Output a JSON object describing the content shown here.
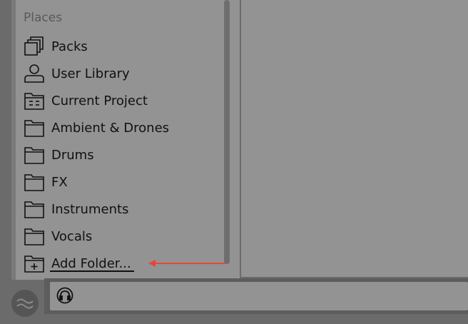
{
  "places": {
    "title": "Places",
    "items": [
      {
        "label": "Packs",
        "icon": "packs-icon"
      },
      {
        "label": "User Library",
        "icon": "user-icon"
      },
      {
        "label": "Current Project",
        "icon": "project-folder-icon"
      },
      {
        "label": "Ambient & Drones",
        "icon": "folder-icon"
      },
      {
        "label": "Drums",
        "icon": "folder-icon"
      },
      {
        "label": "FX",
        "icon": "folder-icon"
      },
      {
        "label": "Instruments",
        "icon": "folder-icon"
      },
      {
        "label": "Vocals",
        "icon": "folder-icon"
      },
      {
        "label": "Add Folder...",
        "icon": "add-folder-icon"
      }
    ]
  },
  "colors": {
    "panel": "#939393",
    "background": "#6b6b6b",
    "arrow": "#e8443a",
    "text": "#111111"
  }
}
